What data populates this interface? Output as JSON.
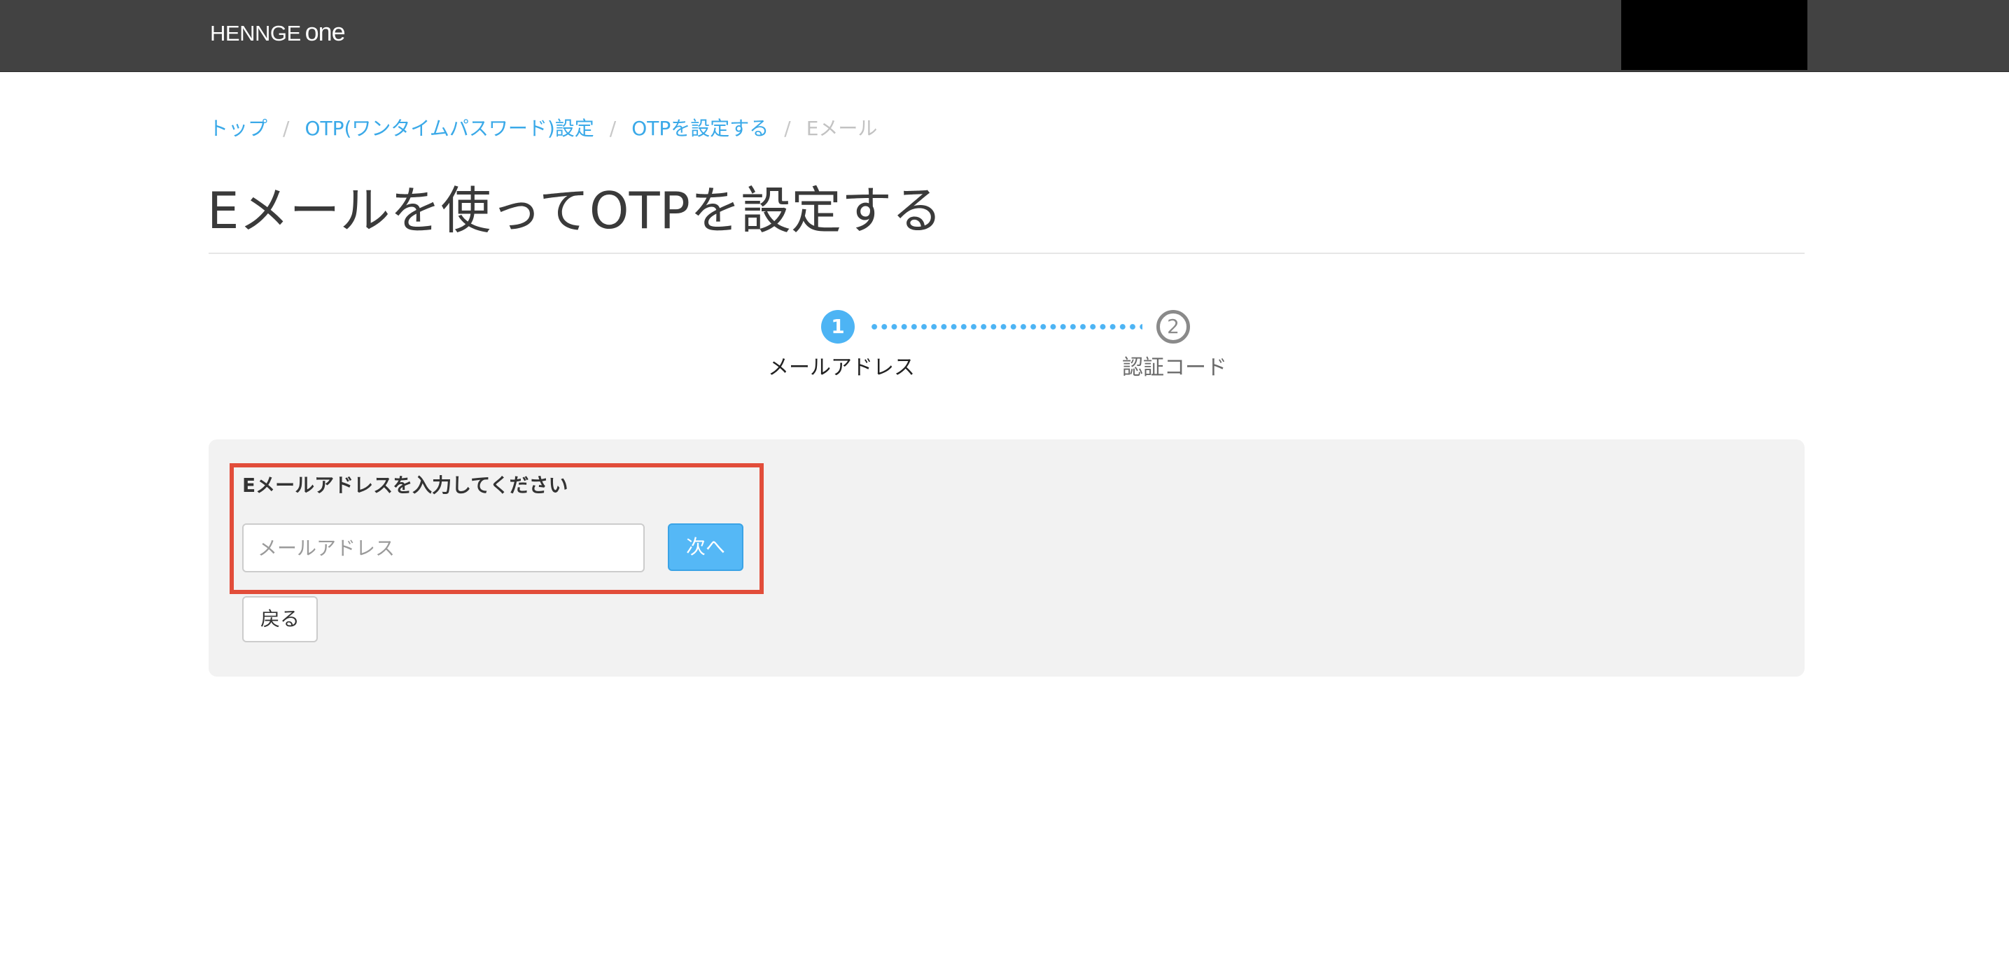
{
  "header": {
    "brand_main": "HENNGE",
    "brand_sub": "one"
  },
  "breadcrumb": {
    "items": [
      "トップ",
      "OTP(ワンタイムパスワード)設定",
      "OTPを設定する"
    ],
    "current": "Eメール",
    "separator": "/"
  },
  "page": {
    "title": "Eメールを使ってOTPを設定する"
  },
  "stepper": {
    "current_step": 1,
    "steps": [
      {
        "number": "1",
        "label": "メールアドレス",
        "state": "active"
      },
      {
        "number": "2",
        "label": "認証コード",
        "state": "pending"
      }
    ]
  },
  "form": {
    "label": "Eメールアドレスを入力してください",
    "email_value": "",
    "email_placeholder": "メールアドレス",
    "next_label": "次へ",
    "back_label": "戻る"
  },
  "colors": {
    "navbar": "#424242",
    "accent": "#4db4f4",
    "link": "#3aa9e8",
    "highlight": "#e24d3a",
    "panel": "#f2f2f2"
  }
}
